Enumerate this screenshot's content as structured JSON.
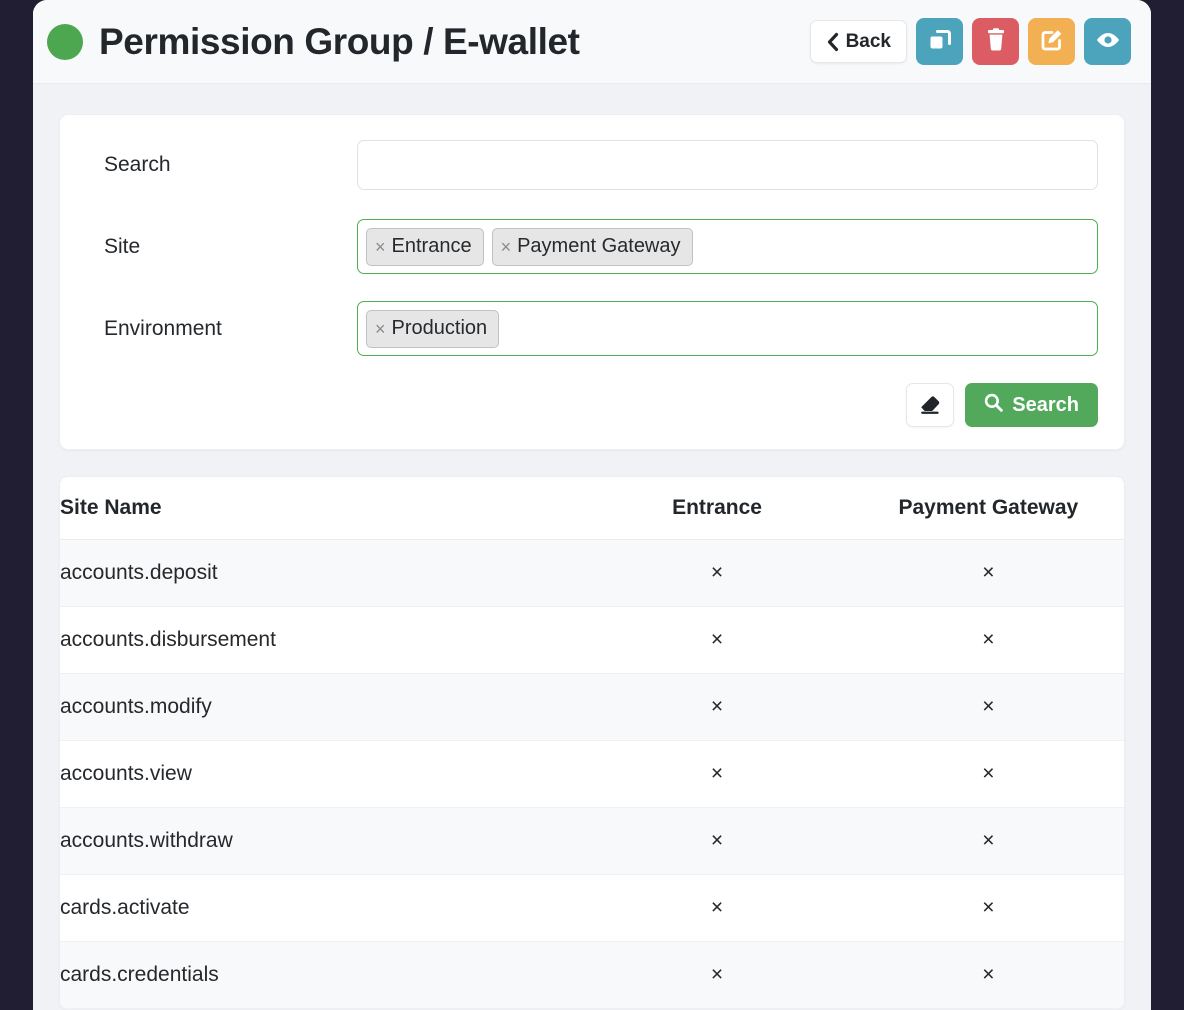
{
  "header": {
    "status_dot_color": "#4ca750",
    "title": "Permission Group / E-wallet",
    "back_label": "Back",
    "actions": [
      {
        "name": "duplicate",
        "icon": "copy-icon",
        "color": "#4ba4bb"
      },
      {
        "name": "delete",
        "icon": "trash-icon",
        "color": "#db5c62"
      },
      {
        "name": "edit",
        "icon": "edit-square-icon",
        "color": "#f2b052"
      },
      {
        "name": "view",
        "icon": "eye-icon",
        "color": "#4ba4bb"
      }
    ]
  },
  "filters": {
    "search": {
      "label": "Search",
      "value": "",
      "placeholder": ""
    },
    "site": {
      "label": "Site",
      "tags": [
        "Entrance",
        "Payment Gateway"
      ],
      "remove_glyph": "×",
      "border_color": "#4caf50"
    },
    "environment": {
      "label": "Environment",
      "tags": [
        "Production"
      ],
      "remove_glyph": "×",
      "border_color": "#4caf50"
    },
    "clear_button": {
      "icon": "eraser-icon",
      "label": ""
    },
    "search_button": {
      "icon": "search-icon",
      "label": "Search",
      "color": "#52a95c"
    }
  },
  "table": {
    "columns": [
      "Site Name",
      "Entrance",
      "Payment Gateway"
    ],
    "mark": "×",
    "rows": [
      {
        "name": "accounts.deposit",
        "entrance": "×",
        "payment_gateway": "×"
      },
      {
        "name": "accounts.disbursement",
        "entrance": "×",
        "payment_gateway": "×"
      },
      {
        "name": "accounts.modify",
        "entrance": "×",
        "payment_gateway": "×"
      },
      {
        "name": "accounts.view",
        "entrance": "×",
        "payment_gateway": "×"
      },
      {
        "name": "accounts.withdraw",
        "entrance": "×",
        "payment_gateway": "×"
      },
      {
        "name": "cards.activate",
        "entrance": "×",
        "payment_gateway": "×"
      },
      {
        "name": "cards.credentials",
        "entrance": "×",
        "payment_gateway": "×"
      }
    ]
  }
}
